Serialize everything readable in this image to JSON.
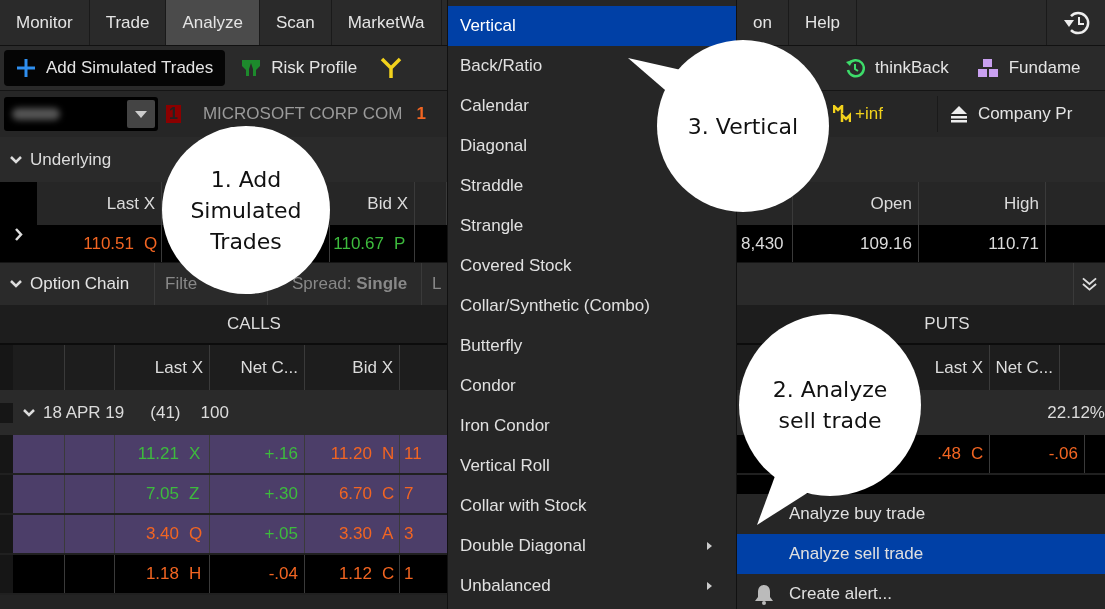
{
  "menu_bar": {
    "tabs": [
      {
        "label": "Monitor",
        "selected": false
      },
      {
        "label": "Trade",
        "selected": false
      },
      {
        "label": "Analyze",
        "selected": true
      },
      {
        "label": "Scan",
        "selected": false
      },
      {
        "label": "MarketWa",
        "selected": false
      }
    ],
    "tabs_after_menu": [
      {
        "label": "on",
        "selected": false
      },
      {
        "label": "Help",
        "selected": false
      }
    ]
  },
  "toolbar": {
    "buttons": [
      {
        "label": "Add Simulated Trades",
        "selected": true
      },
      {
        "label": "Risk Profile",
        "selected": false
      }
    ],
    "right_buttons": [
      {
        "label": "thinkBack"
      },
      {
        "label": "Fundame"
      }
    ]
  },
  "symbol_bar": {
    "alert_count": "1",
    "description": "MICROSOFT CORP COM",
    "change": "1",
    "market_maker": "+inf",
    "company_profile": "Company Pr"
  },
  "underlying": {
    "title": "Underlying",
    "expanded": true,
    "columns": [
      "Last X",
      "Bid X",
      "Open",
      "High"
    ],
    "last": "110.51",
    "last_exchange": "Q",
    "bid": "110.67",
    "bid_exchange": "P",
    "volume": "8,430",
    "open": "109.16",
    "high": "110.71"
  },
  "option_chain": {
    "title": "Option Chain",
    "expanded": true,
    "filter": "Filte",
    "spread": "Spread: **Single**",
    "column_5": "L",
    "calls_label": "CALLS",
    "puts_label": "PUTS",
    "call_columns": [
      "Last X",
      "Net C...",
      "Bid X"
    ],
    "put_columns": [
      "Last X",
      "Net C..."
    ],
    "expiration": {
      "date": "18 APR 19",
      "days": "(41)",
      "multiplier": "100",
      "volatility": "22.12%",
      "expanded": true
    },
    "call_rows": [
      {
        "in_the_money": true,
        "last": "11.21",
        "last_exchange": "X",
        "last_up": true,
        "net_change": "+.16",
        "net_up": true,
        "bid": "11.20",
        "bid_exchange": "N",
        "column_9": "11"
      },
      {
        "in_the_money": true,
        "last": "7.05",
        "last_exchange": "Z",
        "last_up": true,
        "net_change": "+.30",
        "net_up": true,
        "bid": "6.70",
        "bid_exchange": "C",
        "column_9": "7"
      },
      {
        "in_the_money": true,
        "last": "3.40",
        "last_exchange": "Q",
        "last_up": false,
        "net_change": "+.05",
        "net_up": true,
        "bid": "3.30",
        "bid_exchange": "A",
        "column_9": "3"
      },
      {
        "in_the_money": false,
        "last": "1.18",
        "last_exchange": "H",
        "last_up": false,
        "net_change": "-.04",
        "net_up": false,
        "bid": "1.12",
        "bid_exchange": "C",
        "column_9": "1"
      }
    ],
    "put_rows": [
      {
        "last": ".48",
        "last_exchange": "C",
        "last_up": false,
        "net_change": "-.06",
        "net_up": false
      }
    ]
  },
  "strategy_menu": {
    "items": [
      {
        "label": "Vertical",
        "selected": true,
        "has_submenu": false
      },
      {
        "label": "Back/Ratio",
        "selected": false,
        "has_submenu": false
      },
      {
        "label": "Calendar",
        "selected": false,
        "has_submenu": false
      },
      {
        "label": "Diagonal",
        "selected": false,
        "has_submenu": false
      },
      {
        "label": "Straddle",
        "selected": false,
        "has_submenu": false
      },
      {
        "label": "Strangle",
        "selected": false,
        "has_submenu": false
      },
      {
        "label": "Covered Stock",
        "selected": false,
        "has_submenu": false
      },
      {
        "label": "Collar/Synthetic (Combo)",
        "selected": false,
        "has_submenu": false
      },
      {
        "label": "Butterfly",
        "selected": false,
        "has_submenu": false
      },
      {
        "label": "Condor",
        "selected": false,
        "has_submenu": false
      },
      {
        "label": "Iron Condor",
        "selected": false,
        "has_submenu": false
      },
      {
        "label": "Vertical Roll",
        "selected": false,
        "has_submenu": false
      },
      {
        "label": "Collar with Stock",
        "selected": false,
        "has_submenu": false
      },
      {
        "label": "Double Diagonal",
        "selected": false,
        "has_submenu": true
      },
      {
        "label": "Unbalanced",
        "selected": false,
        "has_submenu": true
      }
    ]
  },
  "context_menu": {
    "items": [
      {
        "label": "Analyze buy trade",
        "selected": false
      },
      {
        "label": "Analyze sell trade",
        "selected": true
      },
      {
        "label": "Create alert...",
        "selected": false
      }
    ]
  },
  "callouts": [
    {
      "text": "1. Add Simulated Trades"
    },
    {
      "text": "3. Vertical"
    },
    {
      "text": "2. Analyze sell trade"
    }
  ]
}
